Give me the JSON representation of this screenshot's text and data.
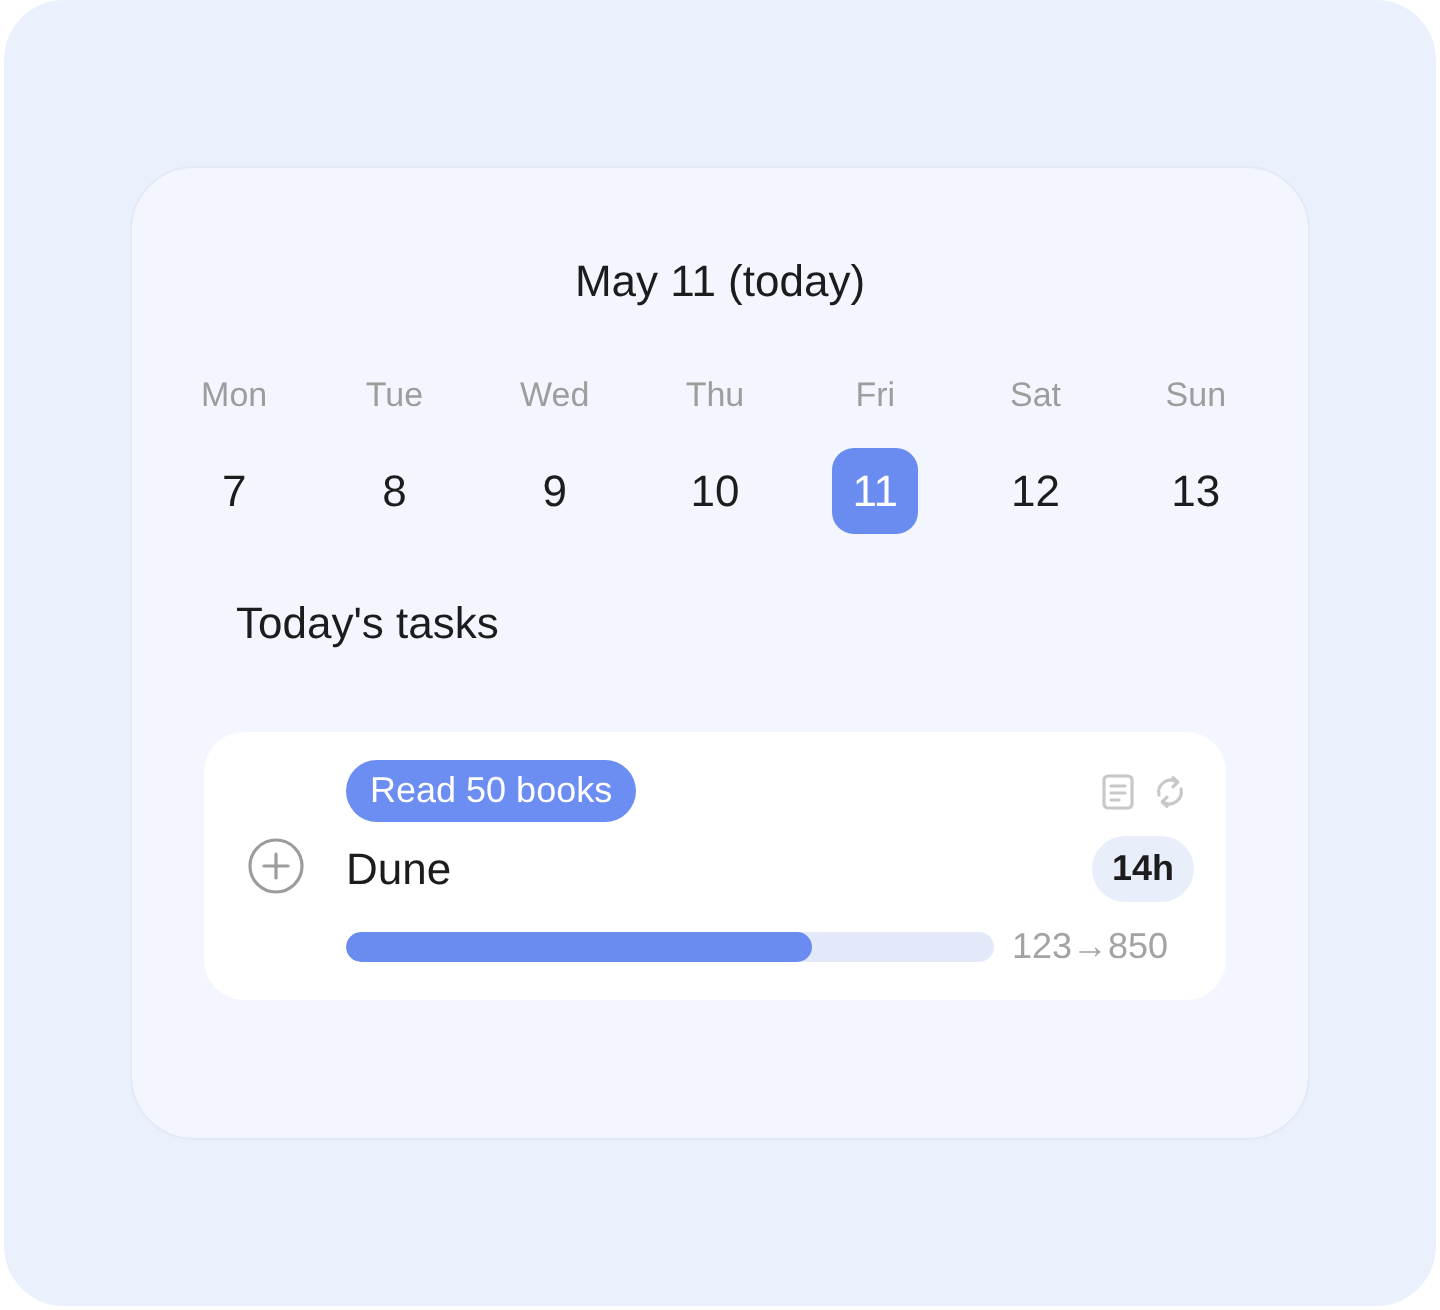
{
  "header": {
    "title": "May 11 (today)"
  },
  "week": [
    {
      "weekday": "Mon",
      "date": "7",
      "selected": false
    },
    {
      "weekday": "Tue",
      "date": "8",
      "selected": false
    },
    {
      "weekday": "Wed",
      "date": "9",
      "selected": false
    },
    {
      "weekday": "Thu",
      "date": "10",
      "selected": false
    },
    {
      "weekday": "Fri",
      "date": "11",
      "selected": true
    },
    {
      "weekday": "Sat",
      "date": "12",
      "selected": false
    },
    {
      "weekday": "Sun",
      "date": "13",
      "selected": false
    }
  ],
  "section_title": "Today's tasks",
  "tasks": [
    {
      "goal": "Read 50 books",
      "name": "Dune",
      "duration": "14h",
      "level": 0.72,
      "progress_text": "123→850"
    }
  ]
}
